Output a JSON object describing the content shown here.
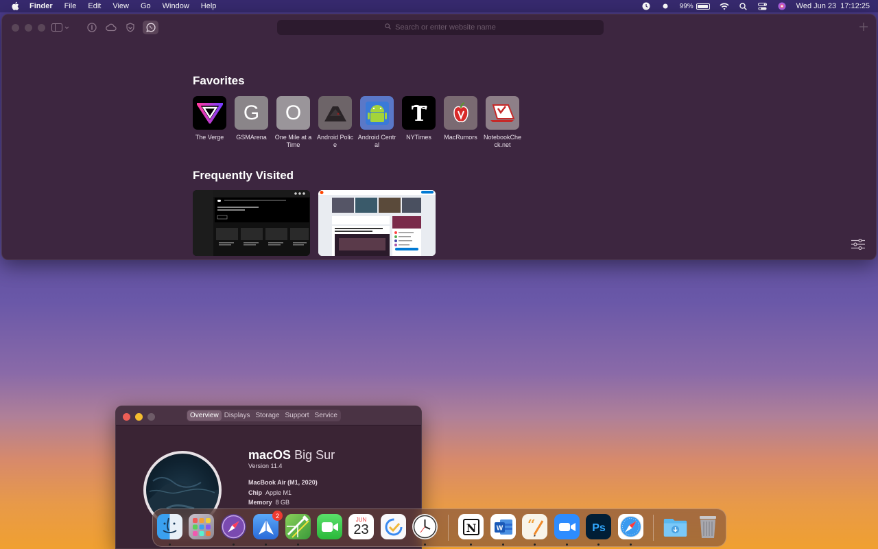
{
  "menubar": {
    "app": "Finder",
    "items": [
      "File",
      "Edit",
      "View",
      "Go",
      "Window",
      "Help"
    ],
    "battery_percent": "99%",
    "date": "Wed Jun 23",
    "time": "17:12:25"
  },
  "safari": {
    "address_placeholder": "Search or enter website name",
    "favorites_title": "Favorites",
    "frequently_title": "Frequently Visited",
    "favorites": [
      {
        "label": "The Verge"
      },
      {
        "label": "GSMArena",
        "letter": "G"
      },
      {
        "label": "One Mile at a Time",
        "letter": "O"
      },
      {
        "label": "Android Police"
      },
      {
        "label": "Android Central"
      },
      {
        "label": "NYTimes"
      },
      {
        "label": "MacRumors"
      },
      {
        "label": "NotebookCheck.net"
      }
    ]
  },
  "about": {
    "tabs": [
      "Overview",
      "Displays",
      "Storage",
      "Support",
      "Service"
    ],
    "os_name_bold": "macOS",
    "os_name_light": "Big Sur",
    "version": "Version 11.4",
    "model": "MacBook Air (M1, 2020)",
    "chip_label": "Chip",
    "chip_value": "Apple M1",
    "memory_label": "Memory",
    "memory_value": "8 GB"
  },
  "dock": {
    "spark_badge": "2",
    "calendar_month": "JUN",
    "calendar_day": "23"
  }
}
